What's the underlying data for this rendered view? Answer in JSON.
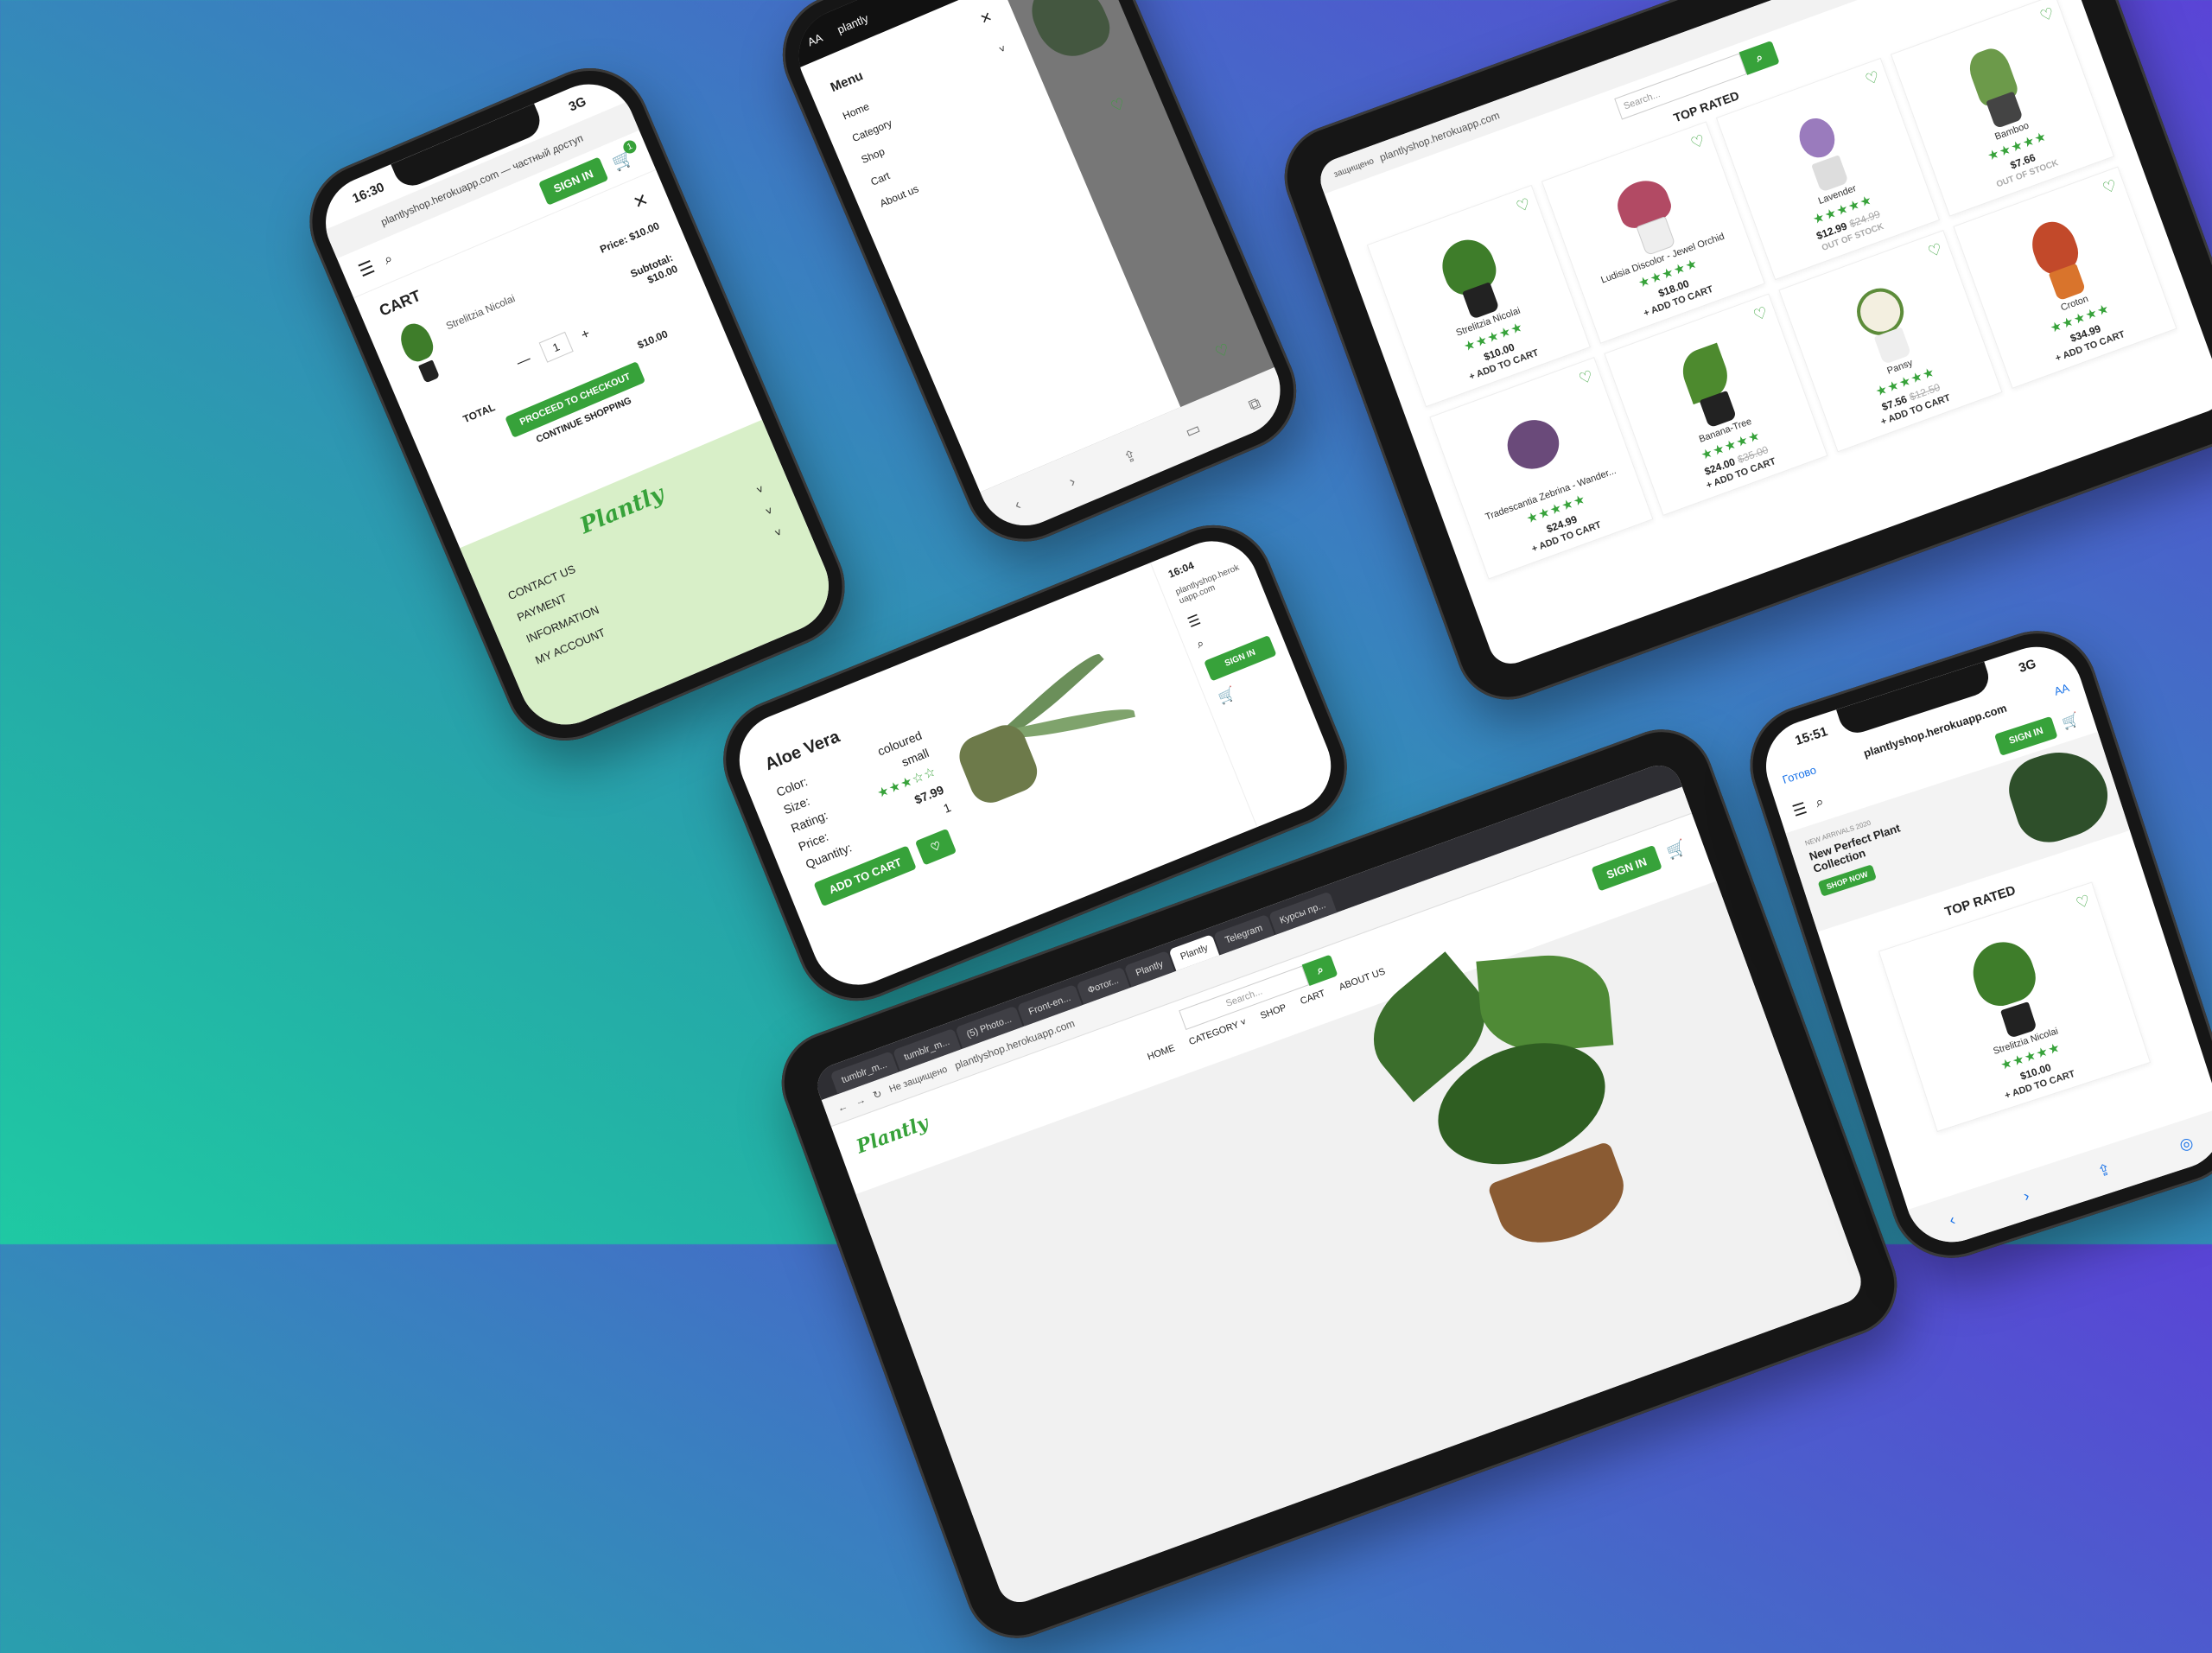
{
  "url": "plantlyshop.herokuapp.com",
  "colors": {
    "brand_green": "#37a23a",
    "footer_green": "#d8efc8"
  },
  "sign_in": "SIGN IN",
  "phone_cart": {
    "time": "16:30",
    "signal": "3G",
    "url": "plantlyshop.herokuapp.com — частный доступ",
    "cart_count": "1",
    "cart_title": "CART",
    "item_name": "Strelitzia Nicolai",
    "price_label": "Price: $10.00",
    "subtotal_label": "Subtotal:",
    "subtotal_value": "$10.00",
    "quantity": "1",
    "minus": "—",
    "plus": "+",
    "total_label": "TOTAL",
    "total_value": "$10.00",
    "checkout": "PROCEED TO CHECKOUT",
    "continue": "CONTINUE SHOPPING",
    "logo": "Plantly",
    "footer_links": [
      "CONTACT US",
      "PAYMENT",
      "INFORMATION",
      "MY ACCOUNT"
    ]
  },
  "phone_menu": {
    "font_toggle": "AA",
    "url": "plantly",
    "menu_title": "Menu",
    "items": [
      "Home",
      "Category",
      "Shop",
      "Cart",
      "About us"
    ]
  },
  "tablet_grid": {
    "url_prefix": "защищено",
    "search_placeholder": "Search...",
    "heading": "TOP RATED",
    "products_row1": [
      {
        "name": "Strelitzia Nicolai",
        "price": "$10.00",
        "old": "",
        "status": "+ ADD TO CART"
      },
      {
        "name": "Ludisia Discolor - Jewel Orchid",
        "price": "$18.00",
        "old": "",
        "status": "+ ADD TO CART"
      },
      {
        "name": "Lavender",
        "price": "$12.99",
        "old": "$24.99",
        "status": "OUT OF STOCK"
      },
      {
        "name": "Bamboo",
        "price": "$7.66",
        "old": "",
        "status": "OUT OF STOCK"
      }
    ],
    "products_row2": [
      {
        "name": "Tradescantia Zebrina - Wander...",
        "price": "$24.99",
        "old": "",
        "status": "+ ADD TO CART"
      },
      {
        "name": "Banana-Tree",
        "price": "$24.00",
        "old": "$35.00",
        "status": "+ ADD TO CART"
      },
      {
        "name": "Pansy",
        "price": "$7.56",
        "old": "$12.50",
        "status": "+ ADD TO CART"
      },
      {
        "name": "Croton",
        "price": "$34.99",
        "old": "",
        "status": "+ ADD TO CART"
      }
    ],
    "stars": "★★★★★"
  },
  "phone_product": {
    "time": "16:04",
    "url": "plantlyshop.herokuapp.com",
    "title": "Aloe Vera",
    "labels": [
      "Color:",
      "Size:",
      "Rating:",
      "Price:",
      "Quantity:"
    ],
    "values": [
      "coloured",
      "small",
      "★★★☆☆",
      "$7.99"
    ],
    "quantity": "1",
    "add_to_cart": "ADD TO CART",
    "heart": "♡"
  },
  "laptop": {
    "tabs": [
      "tumblr_m...",
      "tumblr_m...",
      "(5) Photo...",
      "Front-en...",
      "Фотог...",
      "Plantly",
      "Plantly",
      "Telegram",
      "Курсы пр..."
    ],
    "insecure": "Не защищено",
    "url": "plantlyshop.herokuapp.com",
    "logo": "Plantly",
    "search_placeholder": "Search...",
    "nav": [
      "HOME",
      "CATEGORY ˅",
      "SHOP",
      "CART",
      "ABOUT US"
    ]
  },
  "phone_home": {
    "time": "15:51",
    "signal": "3G",
    "done": "Готово",
    "font_toggle": "AA",
    "url": "plantlyshop.herokuapp.com",
    "hero_kicker": "NEW ARRIVALS 2020",
    "hero_title": "New Perfect Plant Collection",
    "shop_now": "SHOP NOW",
    "heading": "TOP RATED",
    "product_name": "Strelitzia Nicolai",
    "product_price": "$10.00",
    "product_add": "+ ADD TO CART",
    "stars": "★★★★★"
  }
}
